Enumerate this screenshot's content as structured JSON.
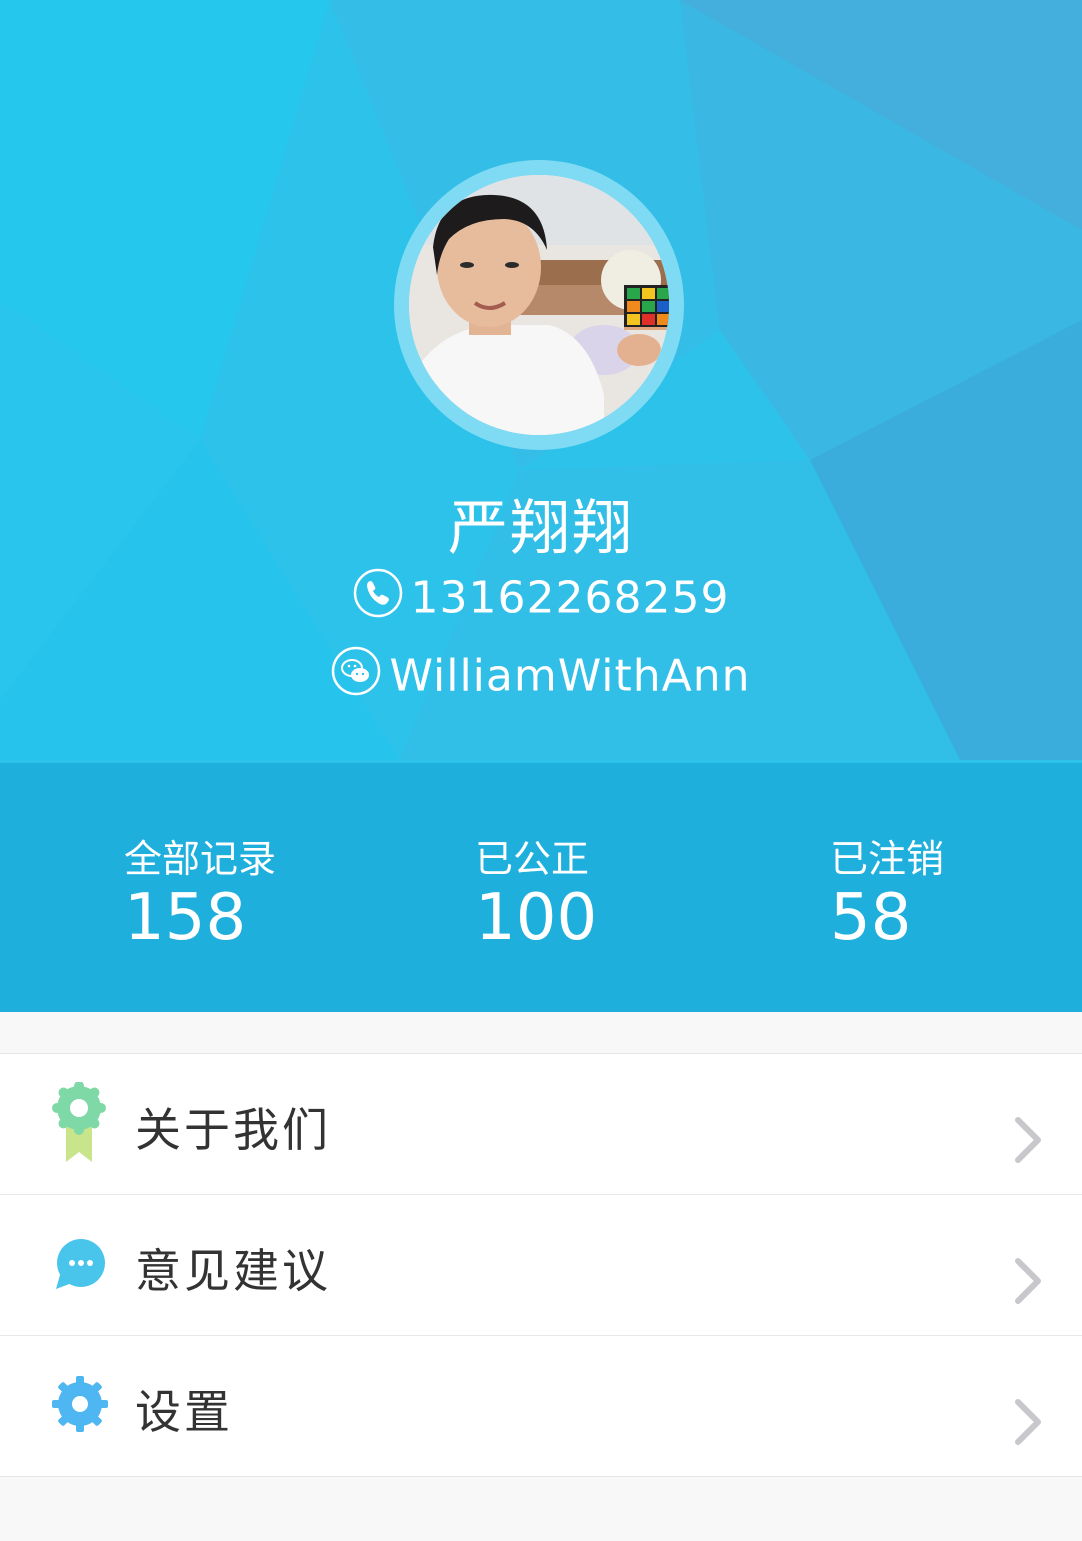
{
  "profile": {
    "name": "严翔翔",
    "phone": "13162268259",
    "wechat": "WilliamWithAnn"
  },
  "stats": [
    {
      "label": "全部记录",
      "value": "158"
    },
    {
      "label": "已公正",
      "value": "100"
    },
    {
      "label": "已注销",
      "value": "58"
    }
  ],
  "menu": [
    {
      "label": "关于我们",
      "icon": "badge-icon"
    },
    {
      "label": "意见建议",
      "icon": "chat-bubble-icon"
    },
    {
      "label": "设置",
      "icon": "gear-icon"
    }
  ],
  "colors": {
    "header_bg": "#2ec3ea",
    "badge_green": "#7ed9a6",
    "chat_blue": "#49c5ec",
    "gear_blue": "#4eb6f0"
  }
}
